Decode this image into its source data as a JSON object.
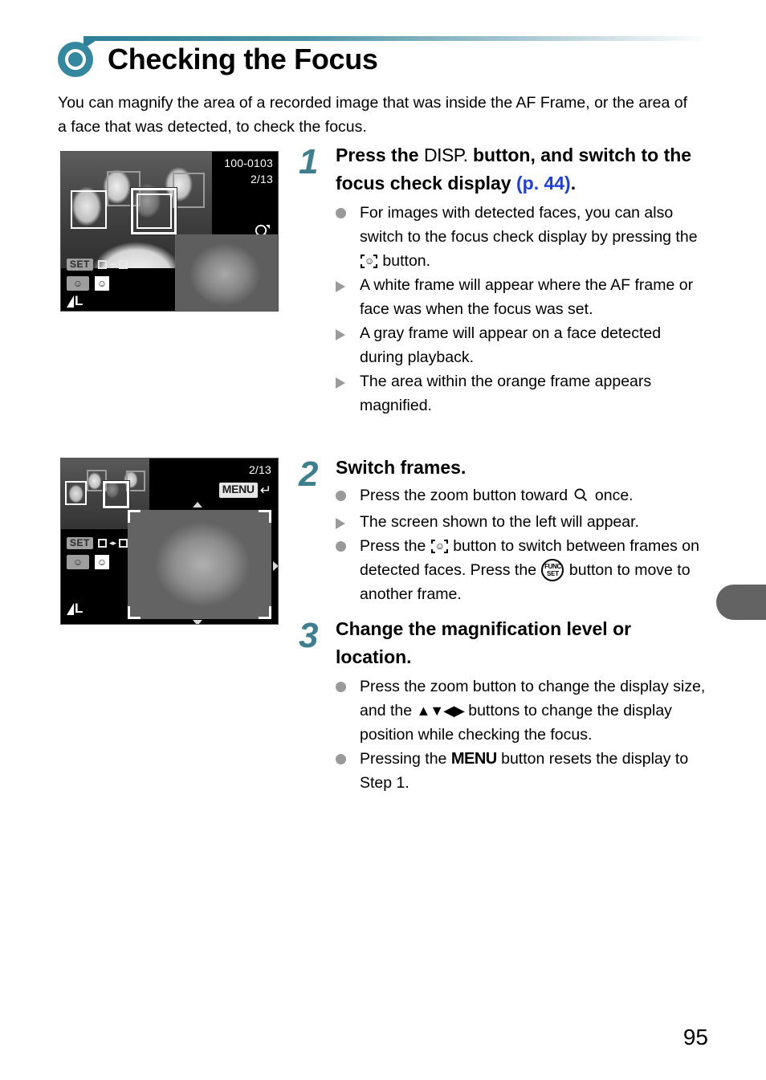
{
  "header": {
    "title": "Checking the Focus",
    "bullet_icon": "filled-ring-icon",
    "accent_color": "#3388a0"
  },
  "intro": "You can magnify the area of a recorded image that was inside the AF Frame, or the area of a face that was detected, to check the focus.",
  "screens": [
    {
      "name": "focus-check-overview",
      "file_number": "100-0103",
      "image_counter": "2/13",
      "zoom_icon": "magnifier-with-arrow-icon",
      "set_badge": "SET",
      "frame_switch_icon": "square-to-square-icon",
      "face_select_icon_gray": "face-select-icon",
      "face_select_icon_white": "face-detect-icon",
      "quality_badge": "L",
      "af_frames": [
        {
          "type": "white",
          "label": "af-frame-white-1"
        },
        {
          "type": "gray",
          "label": "af-frame-gray-1"
        },
        {
          "type": "gray",
          "label": "af-frame-gray-2"
        },
        {
          "type": "orange",
          "label": "af-frame-orange-selected"
        }
      ]
    },
    {
      "name": "focus-check-magnified",
      "image_counter": "2/13",
      "menu_badge": "MENU",
      "menu_return_icon": "return-arrow-icon",
      "set_badge": "SET",
      "frame_switch_icon": "square-to-square-icon",
      "face_select_icon_gray": "face-select-icon",
      "face_select_icon_white": "face-detect-icon",
      "quality_badge": "L",
      "nav_icons": [
        "nav-up-icon",
        "nav-down-icon",
        "nav-right-icon"
      ]
    }
  ],
  "steps": [
    {
      "number": "1",
      "heading_a": "Press the ",
      "heading_disp": "DISP.",
      "heading_b": " button, and switch to the focus check display ",
      "heading_ref": "(p. 44)",
      "heading_c": ".",
      "bullets": [
        {
          "mark": "dot",
          "parts": [
            {
              "t": "text",
              "v": "For images with detected faces, you can also switch to the focus check display by pressing the "
            },
            {
              "t": "icon",
              "v": "face-select-icon"
            },
            {
              "t": "text",
              "v": " button."
            }
          ]
        },
        {
          "mark": "triangle",
          "parts": [
            {
              "t": "text",
              "v": "A white frame will appear where the AF frame or face was when the focus was set."
            }
          ]
        },
        {
          "mark": "triangle",
          "parts": [
            {
              "t": "text",
              "v": "A gray frame will appear on a face detected during playback."
            }
          ]
        },
        {
          "mark": "triangle",
          "parts": [
            {
              "t": "text",
              "v": "The area within the orange frame appears magnified."
            }
          ]
        }
      ]
    },
    {
      "number": "2",
      "heading_a": "Switch frames.",
      "bullets": [
        {
          "mark": "dot",
          "parts": [
            {
              "t": "text",
              "v": "Press the zoom button toward "
            },
            {
              "t": "icon",
              "v": "magnifier-icon"
            },
            {
              "t": "text",
              "v": " once."
            }
          ]
        },
        {
          "mark": "triangle",
          "parts": [
            {
              "t": "text",
              "v": "The screen shown to the left will appear."
            }
          ]
        },
        {
          "mark": "dot",
          "parts": [
            {
              "t": "text",
              "v": "Press the "
            },
            {
              "t": "icon",
              "v": "face-select-icon"
            },
            {
              "t": "text",
              "v": " button to switch between frames on detected faces. Press the "
            },
            {
              "t": "icon",
              "v": "func-set-icon"
            },
            {
              "t": "text",
              "v": " button to move to another frame."
            }
          ]
        }
      ]
    },
    {
      "number": "3",
      "heading_a": "Change the magnification level or location.",
      "bullets": [
        {
          "mark": "dot",
          "parts": [
            {
              "t": "text",
              "v": "Press the zoom button to change the display size, and the "
            },
            {
              "t": "icon",
              "v": "updownleftright-arrows-icon"
            },
            {
              "t": "text",
              "v": " buttons to change the display position while checking the focus."
            }
          ]
        },
        {
          "mark": "dot",
          "parts": [
            {
              "t": "text",
              "v": "Pressing the "
            },
            {
              "t": "icon",
              "v": "menu-glyph-icon"
            },
            {
              "t": "text",
              "v": " button resets the display to Step 1."
            }
          ]
        }
      ]
    }
  ],
  "func_set_icon": {
    "line1": "FUNC",
    "line2": "SET"
  },
  "menu_glyph": "MENU",
  "disp_glyph": "DISP.",
  "page_number": "95",
  "side_tab": {
    "name": "chapter-tab",
    "color": "#636363"
  }
}
